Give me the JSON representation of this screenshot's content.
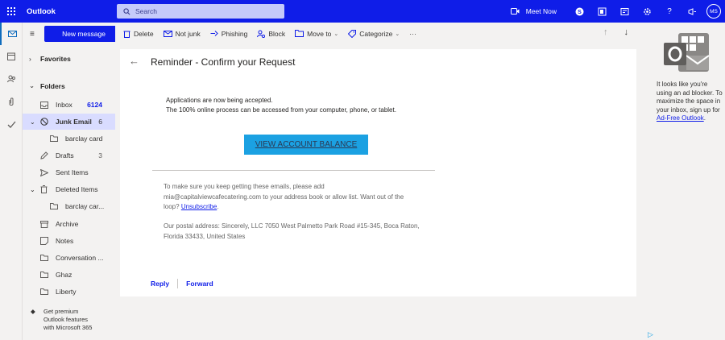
{
  "app": {
    "name": "Outlook"
  },
  "search": {
    "placeholder": "Search"
  },
  "topbar": {
    "meet_now": "Meet Now",
    "avatar_initials": "MS"
  },
  "folder_pane": {
    "new_message": "New message",
    "favorites": "Favorites",
    "folders": "Folders",
    "items": [
      {
        "label": "Inbox",
        "count": "6124"
      },
      {
        "label": "Junk Email",
        "count": "6"
      },
      {
        "label": "barclay card",
        "count": ""
      },
      {
        "label": "Drafts",
        "count": "3"
      },
      {
        "label": "Sent Items",
        "count": ""
      },
      {
        "label": "Deleted Items",
        "count": ""
      },
      {
        "label": "barclay car...",
        "count": ""
      },
      {
        "label": "Archive",
        "count": ""
      },
      {
        "label": "Notes",
        "count": ""
      },
      {
        "label": "Conversation ...",
        "count": ""
      },
      {
        "label": "Ghaz",
        "count": ""
      },
      {
        "label": "Liberty",
        "count": ""
      }
    ],
    "premium": [
      "Get premium",
      "Outlook features",
      "with Microsoft 365"
    ]
  },
  "toolbar": {
    "delete": "Delete",
    "not_junk": "Not junk",
    "phishing": "Phishing",
    "block": "Block",
    "move_to": "Move to",
    "categorize": "Categorize",
    "more": "···"
  },
  "message": {
    "subject": "Reminder - Confirm your Request",
    "line1": "Applications are now being accepted.",
    "line2": "The 100% online process can be accessed from your computer, phone, or tablet.",
    "cta": "VIEW ACCOUNT BALANCE",
    "footer_text": "To make sure you keep getting these emails, please add mia@capitalviewcafecatering.com to your address book or allow list. Want out of the loop?",
    "unsubscribe": "Unsubscribe",
    "address": "Our postal address: Sincerely, LLC 7050 West Palmetto Park Road #15-345, Boca Raton, Florida 33433, United States",
    "reply": "Reply",
    "forward": "Forward"
  },
  "ad_pane": {
    "text": "It looks like you're using an ad blocker. To maximize the space in your inbox, sign up for",
    "link": "Ad-Free Outlook",
    "period": "."
  },
  "colors": {
    "brand": "#0f1de8",
    "cta": "#1ba1e2",
    "selected": "#d9dcff"
  }
}
